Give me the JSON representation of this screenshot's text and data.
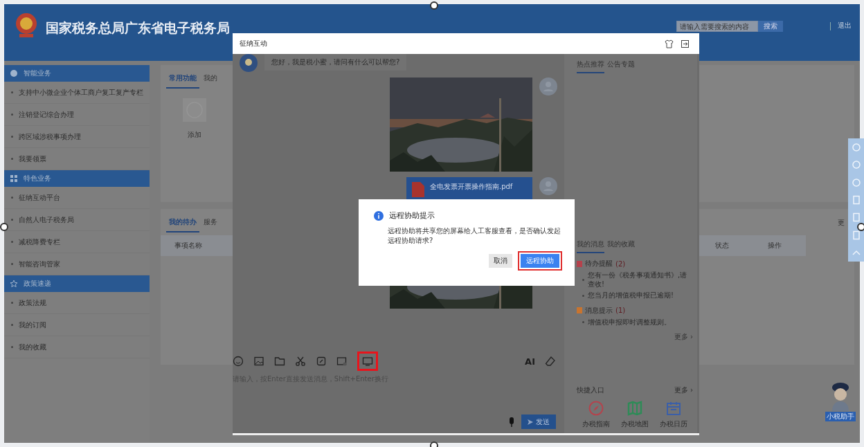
{
  "header": {
    "title": "国家税务总局广东省电子税务局",
    "search": {
      "placeholder": "请输入需要搜索的内容"
    },
    "search_button": "搜索",
    "logout": "退出"
  },
  "sidebar": {
    "sections": [
      {
        "title": "智能业务",
        "items": [
          "支持中小微企业个体工商户复工复产专栏",
          "注销登记综合办理",
          "跨区域涉税事项办理",
          "我要领票"
        ]
      },
      {
        "title": "特色业务",
        "items": [
          "征纳互动平台",
          "自然人电子税务局",
          "减税降费专栏",
          "智能咨询管家"
        ]
      },
      {
        "title": "政策速递",
        "items": [
          "政策法规",
          "我的订阅",
          "我的收藏"
        ]
      }
    ]
  },
  "functions": {
    "tabs": [
      {
        "label": "常用功能",
        "selected": true
      },
      {
        "label": "我的",
        "selected": false
      }
    ],
    "add_label": "添加"
  },
  "todo": {
    "tabs": [
      {
        "label": "我的待办",
        "selected": true
      },
      {
        "label": "服务",
        "selected": false
      }
    ],
    "columns": [
      "事项名称",
      "状态",
      "操作"
    ],
    "more": "更"
  },
  "chat_window": {
    "title": "征纳互动",
    "messages": [
      {
        "kind": "text",
        "from_user": false,
        "text": "您好，我是税小蜜，请问有什么可以帮您?"
      },
      {
        "kind": "picture",
        "from_user": true
      },
      {
        "kind": "file",
        "from_user": true,
        "name": "全电发票开票操作指南.pdf"
      },
      {
        "kind": "picture",
        "from_user": true
      }
    ],
    "toolbar": [
      {
        "annotated": false
      },
      {
        "annotated": false
      },
      {
        "annotated": false
      },
      {
        "annotated": false
      },
      {
        "annotated": false
      },
      {
        "annotated": false
      },
      {
        "annotated": true
      }
    ],
    "ai_label": "AI",
    "input": {
      "placeholder": "请输入，按Enter直接发送消息，Shift+Enter换行"
    },
    "send_button": "发送",
    "side_panel": {
      "top_tabs": [
        {
          "label": "热点推荐",
          "selected": true
        },
        {
          "label": "公告专题",
          "selected": false
        }
      ],
      "message_tabs": [
        {
          "label": "我的消息",
          "selected": true
        },
        {
          "label": "我的收藏",
          "selected": false
        }
      ],
      "groups": [
        {
          "title": "待办提醒",
          "count": "(2)",
          "color": "#b5424c",
          "items": [
            "您有一份《税务事项通知书》,请查收!",
            "您当月的增值税申报已逾期!"
          ]
        },
        {
          "title": "消息提示",
          "count": "(1)",
          "color": "#c8742f",
          "items": [
            "增值税申报即时调整规则。"
          ]
        }
      ],
      "more": "更多 ›",
      "shortcuts": {
        "title": "快捷入口",
        "more": "更多 ›",
        "items": [
          "办税指南",
          "办税地图",
          "办税日历"
        ]
      }
    }
  },
  "dialog": {
    "title": "远程协助提示",
    "message": "远程协助将共享您的屏幕给人工客服查看，是否确认发起远程协助请求?",
    "cancel": "取消",
    "confirm": {
      "label": "远程协助",
      "annotated": true
    }
  },
  "assistant": {
    "label": "小税助手"
  }
}
